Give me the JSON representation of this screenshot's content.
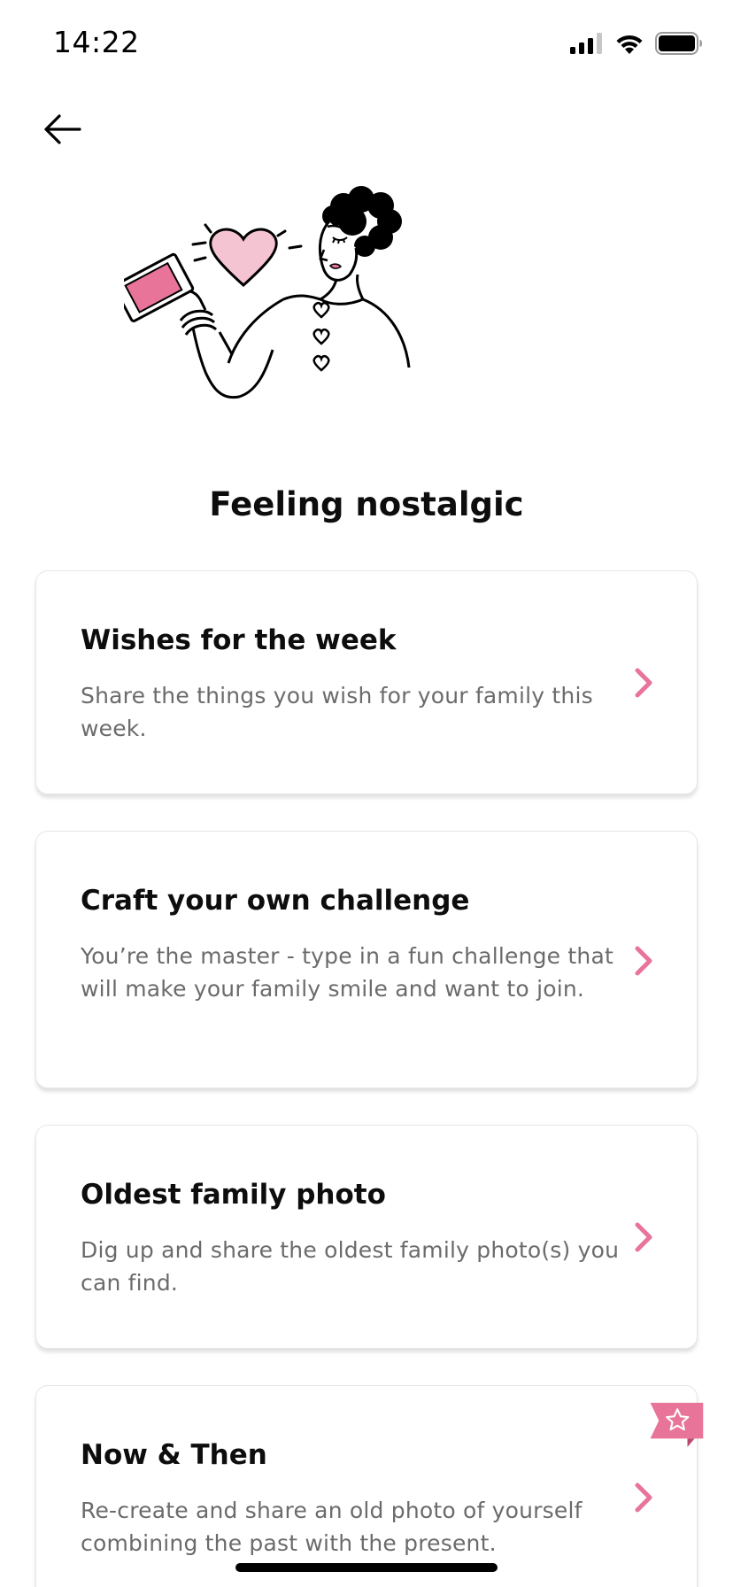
{
  "status_bar": {
    "time": "14:22",
    "signal_icon": "cellular-signal-icon",
    "wifi_icon": "wifi-icon",
    "battery_icon": "battery-icon"
  },
  "nav": {
    "back_icon": "arrow-left-icon"
  },
  "illustration": {
    "name": "woman-holding-photo-illustration"
  },
  "page": {
    "title": "Feeling nostalgic"
  },
  "cards": [
    {
      "title": "Wishes for the week",
      "description": "Share the things you wish for your family this week.",
      "icon": "chevron-right-icon"
    },
    {
      "title": "Craft your own challenge",
      "description": "You’re the master - type in a fun challenge that will make your family smile and want to join.",
      "icon": "chevron-right-icon"
    },
    {
      "title": "Oldest family photo",
      "description": "Dig up and share the oldest family photo(s) you can find.",
      "icon": "chevron-right-icon"
    },
    {
      "title": "Now & Then",
      "description": "Re-create and share an old photo of yourself combining the past with the present.",
      "icon": "chevron-right-icon",
      "badge_icon": "star-ribbon-icon"
    }
  ],
  "colors": {
    "accent_pink": "#e8749a",
    "light_pink": "#f5c4d3",
    "text_primary": "#0d0d0d",
    "text_secondary": "#6b6b6b"
  }
}
